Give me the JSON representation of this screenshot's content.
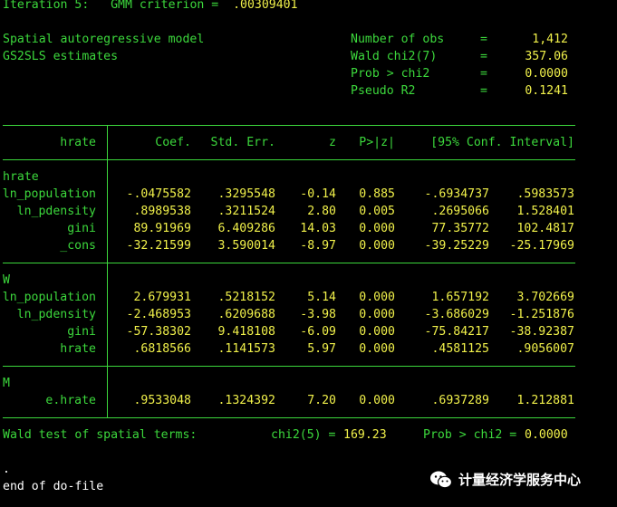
{
  "header": {
    "iteration_label": "Iteration 5:",
    "criterion_label": "GMM criterion =",
    "criterion_value": ".00309401",
    "model_line1": "Spatial autoregressive model",
    "model_line2": "GS2SLS estimates",
    "stats": [
      {
        "label": "Number of obs",
        "eq": "=",
        "value": "1,412"
      },
      {
        "label": "Wald chi2(7)",
        "eq": "=",
        "value": "357.06"
      },
      {
        "label": "Prob > chi2",
        "eq": "=",
        "value": "0.0000"
      },
      {
        "label": "Pseudo R2",
        "eq": "=",
        "value": "0.1241"
      }
    ]
  },
  "table": {
    "depvar": "hrate",
    "columns": [
      "Coef.",
      "Std. Err.",
      "z",
      "P>|z|",
      "[95% Conf. Interval]"
    ],
    "groups": [
      {
        "name": "hrate",
        "rows": [
          {
            "var": "ln_population",
            "coef": "-.0475582",
            "se": ".3295548",
            "z": "-0.14",
            "p": "0.885",
            "lo": "-.6934737",
            "hi": ".5983573"
          },
          {
            "var": "ln_pdensity",
            "coef": ".8989538",
            "se": ".3211524",
            "z": "2.80",
            "p": "0.005",
            "lo": ".2695066",
            "hi": "1.528401"
          },
          {
            "var": "gini",
            "coef": "89.91969",
            "se": "6.409286",
            "z": "14.03",
            "p": "0.000",
            "lo": "77.35772",
            "hi": "102.4817"
          },
          {
            "var": "_cons",
            "coef": "-32.21599",
            "se": "3.590014",
            "z": "-8.97",
            "p": "0.000",
            "lo": "-39.25229",
            "hi": "-25.17969"
          }
        ]
      },
      {
        "name": "W",
        "rows": [
          {
            "var": "ln_population",
            "coef": "2.679931",
            "se": ".5218152",
            "z": "5.14",
            "p": "0.000",
            "lo": "1.657192",
            "hi": "3.702669"
          },
          {
            "var": "ln_pdensity",
            "coef": "-2.468953",
            "se": ".6209688",
            "z": "-3.98",
            "p": "0.000",
            "lo": "-3.686029",
            "hi": "-1.251876"
          },
          {
            "var": "gini",
            "coef": "-57.38302",
            "se": "9.418108",
            "z": "-6.09",
            "p": "0.000",
            "lo": "-75.84217",
            "hi": "-38.92387"
          },
          {
            "var": "hrate",
            "coef": ".6818566",
            "se": ".1141573",
            "z": "5.97",
            "p": "0.000",
            "lo": ".4581125",
            "hi": ".9056007"
          }
        ]
      },
      {
        "name": "M",
        "rows": [
          {
            "var": "e.hrate",
            "coef": ".9533048",
            "se": ".1324392",
            "z": "7.20",
            "p": "0.000",
            "lo": ".6937289",
            "hi": "1.212881"
          }
        ]
      }
    ]
  },
  "wald": {
    "label": "Wald test of spatial terms:",
    "chi_label": "chi2(5) =",
    "chi_value": "169.23",
    "prob_label": "Prob > chi2 =",
    "prob_value": "0.0000"
  },
  "footer": {
    "dot": ".",
    "end": "end of do-file"
  },
  "watermark": {
    "text": "计量经济学服务中心",
    "icon": "wechat-icon"
  },
  "colors": {
    "background": "#000000",
    "text_green": "#3cd83c",
    "value_yellow": "#f0f04a"
  }
}
